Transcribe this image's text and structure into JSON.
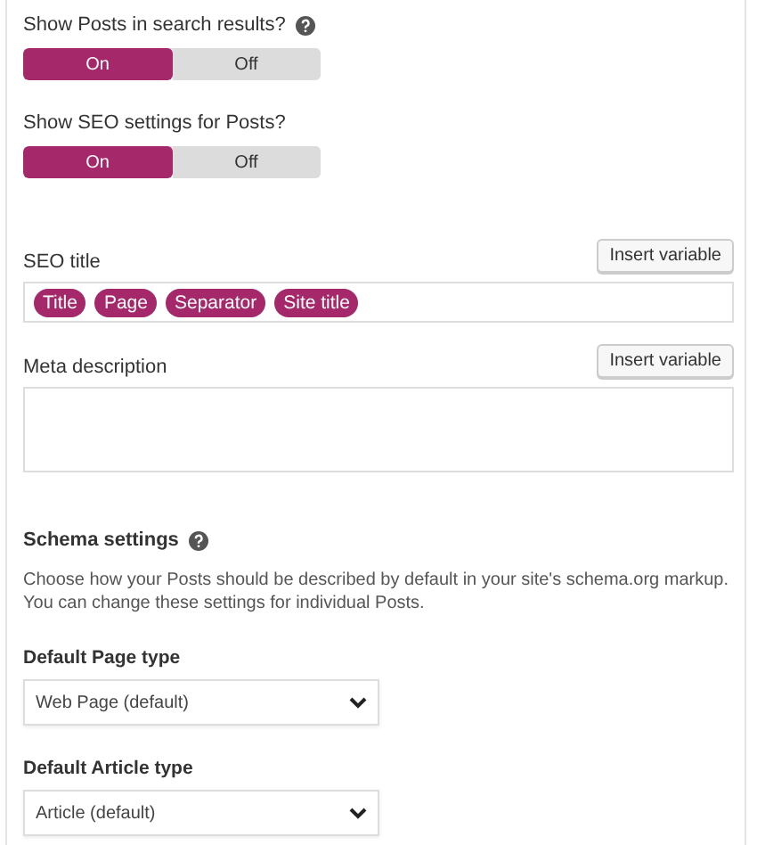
{
  "toggles": [
    {
      "label": "Show Posts in search results?",
      "help": true,
      "options": [
        {
          "label": "On",
          "selected": true
        },
        {
          "label": "Off",
          "selected": false
        }
      ]
    },
    {
      "label": "Show SEO settings for Posts?",
      "help": false,
      "options": [
        {
          "label": "On",
          "selected": true
        },
        {
          "label": "Off",
          "selected": false
        }
      ]
    }
  ],
  "seo_title": {
    "label": "SEO title",
    "button": "Insert variable",
    "tags": [
      "Title",
      "Page",
      "Separator",
      "Site title"
    ]
  },
  "meta_description": {
    "label": "Meta description",
    "button": "Insert variable"
  },
  "schema": {
    "title": "Schema settings",
    "description": "Choose how your Posts should be described by default in your site's schema.org markup. You can change these settings for individual Posts.",
    "selects": [
      {
        "label": "Default Page type",
        "value": "Web Page (default)"
      },
      {
        "label": "Default Article type",
        "value": "Article (default)"
      }
    ]
  }
}
